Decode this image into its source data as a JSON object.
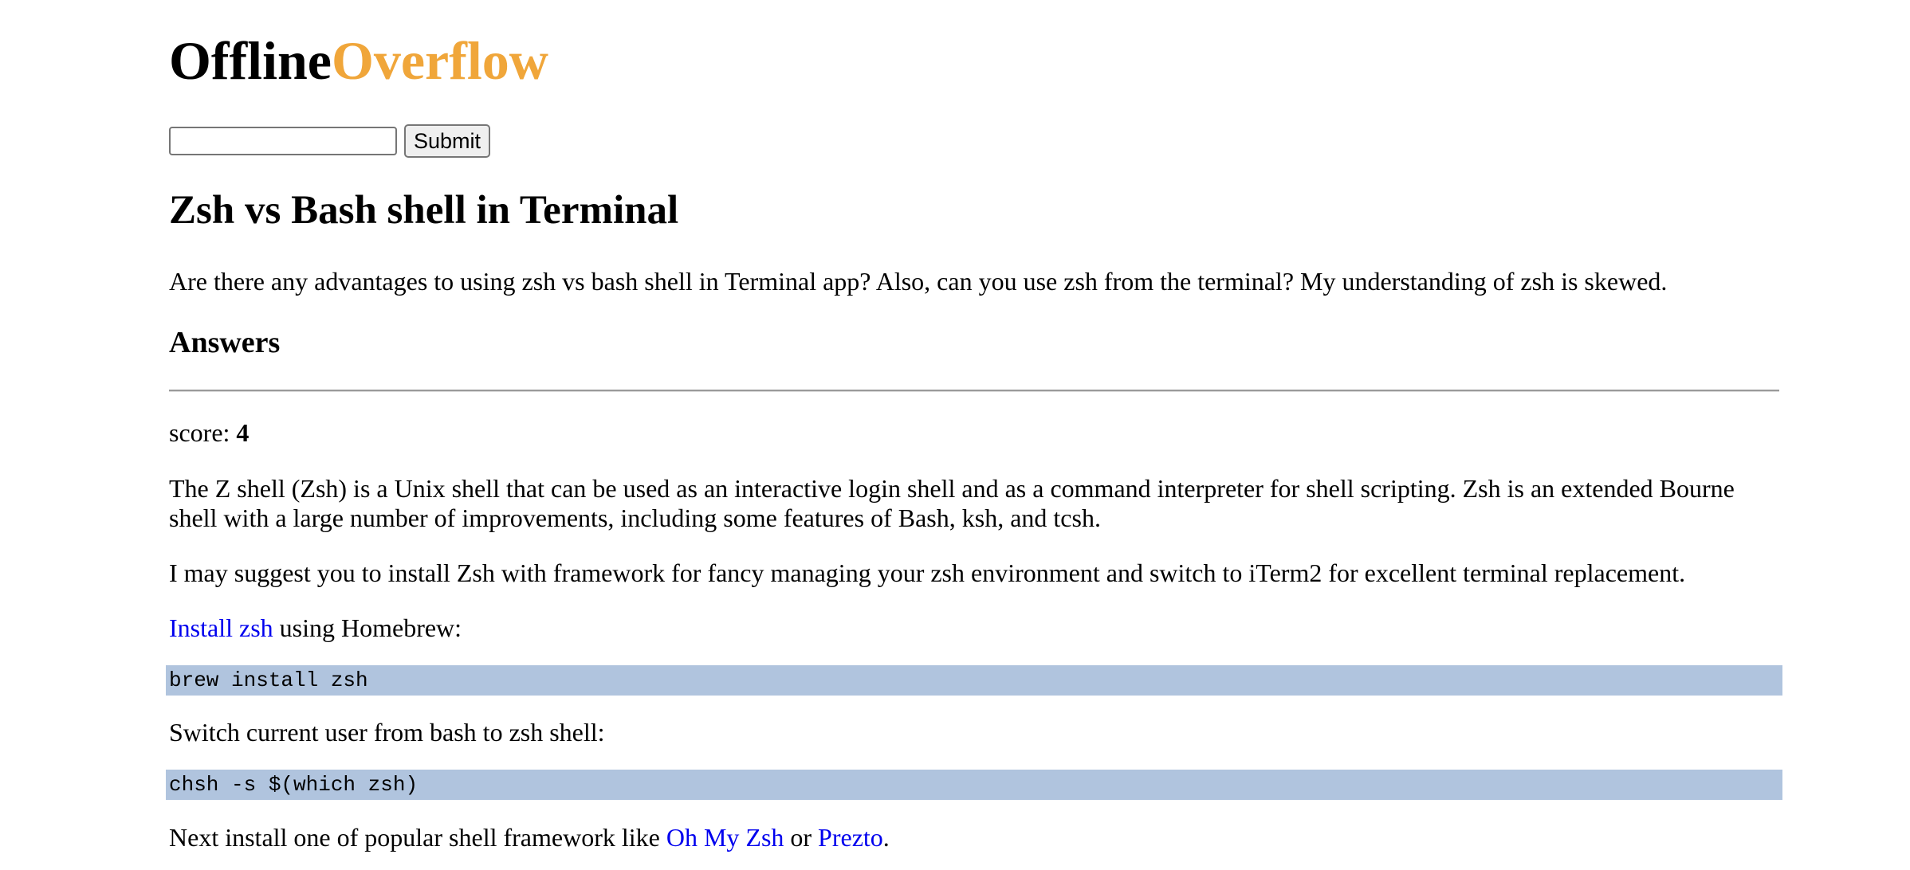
{
  "logo": {
    "part1": "Offline",
    "part2": "Overflow"
  },
  "search": {
    "value": "",
    "submit_label": "Submit"
  },
  "question": {
    "title": "Zsh vs Bash shell in Terminal",
    "body": "Are there any advantages to using zsh vs bash shell in Terminal app? Also, can you use zsh from the terminal? My understanding of zsh is skewed."
  },
  "answers": {
    "heading": "Answers",
    "items": [
      {
        "score_label": "score:",
        "score": "4",
        "paragraph1": "The Z shell (Zsh) is a Unix shell that can be used as an interactive login shell and as a command interpreter for shell scripting. Zsh is an extended Bourne shell with a large number of improvements, including some features of Bash, ksh, and tcsh.",
        "paragraph2": "I may suggest you to install Zsh with framework for fancy managing your zsh environment and switch to iTerm2 for excellent terminal replacement.",
        "install_link": "Install zsh",
        "install_suffix": " using Homebrew:",
        "code1": "brew install zsh",
        "switch_text": "Switch current user from bash to zsh shell:",
        "code2": "chsh -s $(which zsh)",
        "next_prefix": "Next install one of popular shell framework like ",
        "link_ohmyzsh": "Oh My Zsh",
        "or_text": " or ",
        "link_prezto": "Prezto",
        "end_period": "."
      }
    ]
  },
  "colors": {
    "logo_accent": "#f0a63a",
    "link": "#0000ee",
    "code_background": "#b0c4de"
  }
}
